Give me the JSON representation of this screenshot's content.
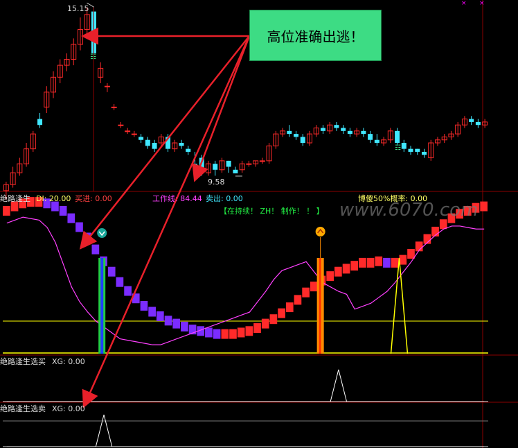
{
  "colors": {
    "background": "#000000",
    "up": "#ff2a2a",
    "down": "#40e8ff",
    "divider": "#8b0000",
    "callout_bg": "#3ddc84",
    "arrow": "#e8202a",
    "white_line": "#ffffff",
    "magenta": "#ff40ff",
    "yellow": "#ffff00",
    "purple": "#7b2cff",
    "orange": "#ff8c00",
    "green": "#22cc44",
    "blue": "#2040ff"
  },
  "top_markers": [
    "×",
    "×"
  ],
  "callout": {
    "text": "高位准确出逃！"
  },
  "price_panel": {
    "high_label": "15.15",
    "low_label": "9.58",
    "signal_icon": "☷"
  },
  "indicator_panel": {
    "name": "绝路逢生",
    "di_label": "DI: 20.00",
    "buy_label": "买进: 0.00",
    "work_label": "工作线: 84.44",
    "sell_label": "卖出: 0.00",
    "prob_label": "博傻50%概率: 0.00",
    "hold_label": "【在持续！ ZH！ 制作！ ！ 】",
    "watermark": "www.6070.com",
    "icon_down": "down-arrow-icon",
    "icon_up": "up-arrow-icon"
  },
  "buy_panel": {
    "name": "绝路逢生选买",
    "xg_label": "XG: 0.00"
  },
  "sell_panel": {
    "name": "绝路逢生选卖",
    "xg_label": "XG: 0.00"
  },
  "chart_data": [
    {
      "type": "candlestick",
      "title": "",
      "annotations": [
        "15.15",
        "9.58"
      ],
      "candles": [
        [
          9.0,
          9.2,
          8.7,
          9.3
        ],
        [
          9.2,
          9.6,
          9.1,
          9.8
        ],
        [
          9.6,
          9.9,
          9.5,
          10.1
        ],
        [
          9.9,
          10.4,
          9.8,
          10.6
        ],
        [
          10.4,
          10.9,
          10.3,
          11.0
        ],
        [
          11.4,
          11.2,
          11.1,
          11.6
        ],
        [
          11.8,
          12.3,
          11.6,
          12.5
        ],
        [
          12.3,
          12.8,
          12.1,
          13.0
        ],
        [
          12.8,
          13.2,
          12.6,
          13.4
        ],
        [
          13.2,
          13.4,
          13.0,
          13.6
        ],
        [
          13.4,
          13.9,
          13.2,
          14.1
        ],
        [
          13.9,
          14.4,
          13.7,
          14.8
        ],
        [
          14.4,
          14.9,
          14.2,
          15.15
        ],
        [
          15.0,
          13.6,
          13.4,
          15.15
        ],
        [
          12.8,
          13.1,
          12.6,
          13.3
        ],
        [
          12.5,
          12.5,
          12.3,
          12.6
        ],
        [
          11.8,
          11.8,
          11.7,
          11.9
        ],
        [
          11.2,
          11.2,
          11.1,
          11.3
        ],
        [
          11.0,
          11.0,
          10.9,
          11.1
        ],
        [
          10.9,
          10.9,
          10.8,
          11.0
        ],
        [
          10.8,
          10.7,
          10.6,
          10.9
        ],
        [
          10.7,
          10.5,
          10.4,
          10.8
        ],
        [
          10.6,
          10.4,
          10.3,
          10.7
        ],
        [
          10.6,
          10.8,
          10.5,
          10.9
        ],
        [
          10.8,
          10.4,
          10.3,
          10.9
        ],
        [
          10.4,
          10.6,
          10.3,
          10.7
        ],
        [
          10.6,
          10.5,
          10.4,
          10.7
        ],
        [
          10.4,
          10.3,
          10.2,
          10.5
        ],
        [
          9.9,
          9.8,
          9.7,
          10.3
        ],
        [
          10.1,
          9.6,
          9.5,
          10.2
        ],
        [
          9.6,
          9.9,
          9.5,
          10.0
        ],
        [
          9.9,
          9.7,
          9.5,
          10.0
        ],
        [
          9.7,
          10.0,
          9.6,
          10.1
        ],
        [
          10.0,
          9.8,
          9.6,
          10.0
        ],
        [
          9.7,
          9.58,
          9.58,
          9.8
        ],
        [
          9.7,
          9.9,
          9.6,
          10.0
        ],
        [
          9.9,
          9.9,
          9.8,
          10.0
        ],
        [
          9.9,
          10.0,
          9.8,
          10.0
        ],
        [
          10.0,
          10.0,
          9.9,
          10.1
        ],
        [
          10.0,
          10.5,
          9.9,
          10.6
        ],
        [
          10.5,
          10.9,
          10.4,
          11.0
        ],
        [
          10.9,
          11.0,
          10.8,
          11.1
        ],
        [
          11.0,
          10.9,
          10.8,
          11.2
        ],
        [
          10.9,
          10.8,
          10.7,
          11.0
        ],
        [
          10.8,
          10.6,
          10.5,
          10.9
        ],
        [
          10.6,
          10.9,
          10.5,
          11.0
        ],
        [
          10.9,
          11.1,
          10.8,
          11.2
        ],
        [
          11.1,
          11.0,
          10.9,
          11.2
        ],
        [
          11.0,
          11.2,
          10.9,
          11.3
        ],
        [
          11.2,
          11.1,
          11.0,
          11.3
        ],
        [
          11.1,
          11.0,
          10.9,
          11.2
        ],
        [
          11.0,
          10.9,
          10.8,
          11.1
        ],
        [
          10.9,
          11.0,
          10.8,
          11.1
        ],
        [
          11.0,
          10.9,
          10.8,
          11.1
        ],
        [
          10.9,
          10.7,
          10.6,
          11.0
        ],
        [
          10.7,
          10.6,
          10.5,
          10.9
        ],
        [
          10.6,
          10.7,
          10.5,
          10.8
        ],
        [
          10.7,
          11.0,
          10.6,
          11.1
        ],
        [
          11.0,
          10.6,
          10.5,
          11.1
        ],
        [
          10.6,
          10.4,
          10.3,
          10.7
        ],
        [
          10.4,
          10.3,
          10.2,
          10.5
        ],
        [
          10.4,
          10.3,
          10.2,
          10.4
        ],
        [
          10.3,
          10.2,
          10.1,
          10.4
        ],
        [
          10.1,
          10.6,
          10.0,
          10.7
        ],
        [
          10.6,
          10.7,
          10.5,
          10.8
        ],
        [
          10.7,
          10.8,
          10.6,
          10.9
        ],
        [
          10.8,
          10.9,
          10.7,
          11.0
        ],
        [
          10.9,
          11.2,
          10.8,
          11.3
        ],
        [
          11.2,
          11.4,
          11.1,
          11.5
        ],
        [
          11.4,
          11.3,
          11.2,
          11.5
        ],
        [
          11.3,
          11.2,
          11.1,
          11.4
        ],
        [
          11.2,
          11.3,
          11.1,
          11.4
        ]
      ]
    },
    {
      "type": "line",
      "title": "绝路逢生",
      "ylim": [
        0,
        100
      ],
      "series": [
        {
          "name": "DI",
          "values": [
            93,
            96,
            98,
            99,
            99,
            98,
            96,
            93,
            88,
            82,
            75,
            67,
            59,
            52,
            45,
            39,
            34,
            29,
            25,
            22,
            19,
            17,
            15,
            13,
            12,
            11,
            10,
            10,
            10,
            11,
            12,
            14,
            17,
            20,
            24,
            28,
            33,
            38,
            42,
            46,
            49,
            52,
            54,
            56,
            58,
            58,
            59,
            58,
            58,
            60,
            64,
            69,
            74,
            79,
            84,
            88,
            91,
            93,
            95,
            96
          ]
        },
        {
          "name": "工作线",
          "values": [
            88,
            90,
            92,
            91,
            90,
            85,
            75,
            60,
            45,
            35,
            28,
            22,
            18,
            14,
            10,
            9,
            8,
            7,
            6,
            6,
            8,
            10,
            12,
            14,
            16,
            18,
            20,
            22,
            24,
            26,
            28,
            35,
            42,
            50,
            56,
            58,
            60,
            62,
            55,
            48,
            45,
            42,
            40,
            30,
            32,
            34,
            38,
            42,
            48,
            55,
            62,
            70,
            75,
            80,
            84,
            86,
            86,
            85,
            84,
            84
          ]
        },
        {
          "name": "卖出",
          "values": [
            0,
            0,
            0,
            0,
            0,
            0,
            0,
            0,
            0,
            0,
            0,
            0,
            0,
            0,
            0,
            0,
            0,
            0,
            0,
            0,
            0,
            0,
            0,
            0,
            0,
            0,
            0,
            0,
            0,
            0,
            0,
            0,
            0,
            0,
            0,
            0,
            0,
            0,
            0,
            0,
            0,
            0,
            0,
            0,
            0,
            0,
            0,
            0,
            0,
            0,
            0,
            0,
            0,
            0,
            0,
            0,
            0,
            0,
            0,
            0
          ]
        }
      ]
    },
    {
      "type": "line",
      "title": "绝路逢生选买",
      "series": [
        {
          "name": "XG",
          "values": [
            0,
            0,
            0,
            0,
            0,
            0,
            0,
            0,
            0,
            0,
            0,
            0,
            0,
            0,
            0,
            0,
            0,
            0,
            0,
            0,
            0,
            0,
            0,
            0,
            0,
            0,
            0,
            0,
            0,
            0,
            0,
            0,
            0,
            0,
            0,
            0,
            0,
            0,
            0,
            0,
            0,
            1,
            0,
            0,
            0,
            0,
            0,
            0,
            0,
            0,
            0,
            0,
            0,
            0,
            0,
            0,
            0,
            0,
            0,
            0
          ]
        }
      ]
    },
    {
      "type": "line",
      "title": "绝路逢生选卖",
      "series": [
        {
          "name": "XG",
          "values": [
            0,
            0,
            0,
            0,
            0,
            0,
            0,
            0,
            0,
            0,
            0,
            0,
            1,
            0,
            0,
            0,
            0,
            0,
            0,
            0,
            0,
            0,
            0,
            0,
            0,
            0,
            0,
            0,
            0,
            0,
            0,
            0,
            0,
            0,
            0,
            0,
            0,
            0,
            0,
            0,
            0,
            0,
            0,
            0,
            0,
            0,
            0,
            0,
            0,
            0,
            0,
            0,
            0,
            0,
            0,
            0,
            0,
            0,
            0,
            0
          ]
        }
      ]
    }
  ]
}
